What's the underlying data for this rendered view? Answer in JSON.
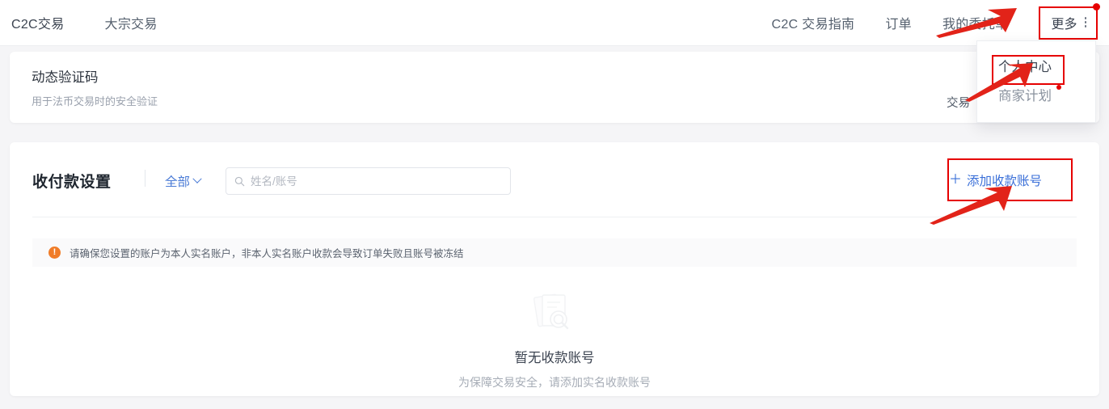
{
  "nav": {
    "left_items": [
      {
        "label": "C2C交易",
        "name": "nav-c2c-trade"
      },
      {
        "label": "大宗交易",
        "name": "nav-block-trade"
      }
    ],
    "right_items": [
      {
        "label": "C2C 交易指南",
        "name": "nav-c2c-guide"
      },
      {
        "label": "订单",
        "name": "nav-orders"
      },
      {
        "label": "我的委托单",
        "name": "nav-my-ads"
      }
    ],
    "more_label": "更多",
    "more_icon": "kebab-vertical-icon",
    "badge_dot": true,
    "highlight_color": "#e60000"
  },
  "dropdown": {
    "items": [
      {
        "label": "个人中心",
        "name": "dropdown-item-personal-center",
        "highlighted": true,
        "dot": false
      },
      {
        "label": "商家计划",
        "name": "dropdown-item-merchant-plan",
        "highlighted": false,
        "dot": true
      }
    ]
  },
  "otp_card": {
    "title": "动态验证码",
    "subtitle": "用于法币交易时的安全验证",
    "right_text": "交易"
  },
  "payment": {
    "title": "收付款设置",
    "filter_label": "全部",
    "filter_icon": "chevron-down-icon",
    "search": {
      "placeholder": "姓名/账号",
      "value": "",
      "icon": "search-icon"
    },
    "add_button": {
      "label": "添加收款账号",
      "plus": "＋",
      "accent": "#3a6fd8"
    },
    "warning": {
      "icon": "exclamation-circle-icon",
      "glyph": "!",
      "text": "请确保您设置的账户为本人实名账户，非本人实名账户收款会导致订单失败且账号被冻结",
      "icon_color": "#f07c28"
    },
    "empty_state": {
      "icon": "documents-search-icon",
      "title": "暂无收款账号",
      "subtitle": "为保障交易安全，请添加实名收款账号"
    }
  },
  "annotations": {
    "arrow_color": "#e22319",
    "arrows": [
      {
        "name": "arrow-to-more-button"
      },
      {
        "name": "arrow-to-personal-center"
      },
      {
        "name": "arrow-to-add-account-button"
      }
    ]
  }
}
